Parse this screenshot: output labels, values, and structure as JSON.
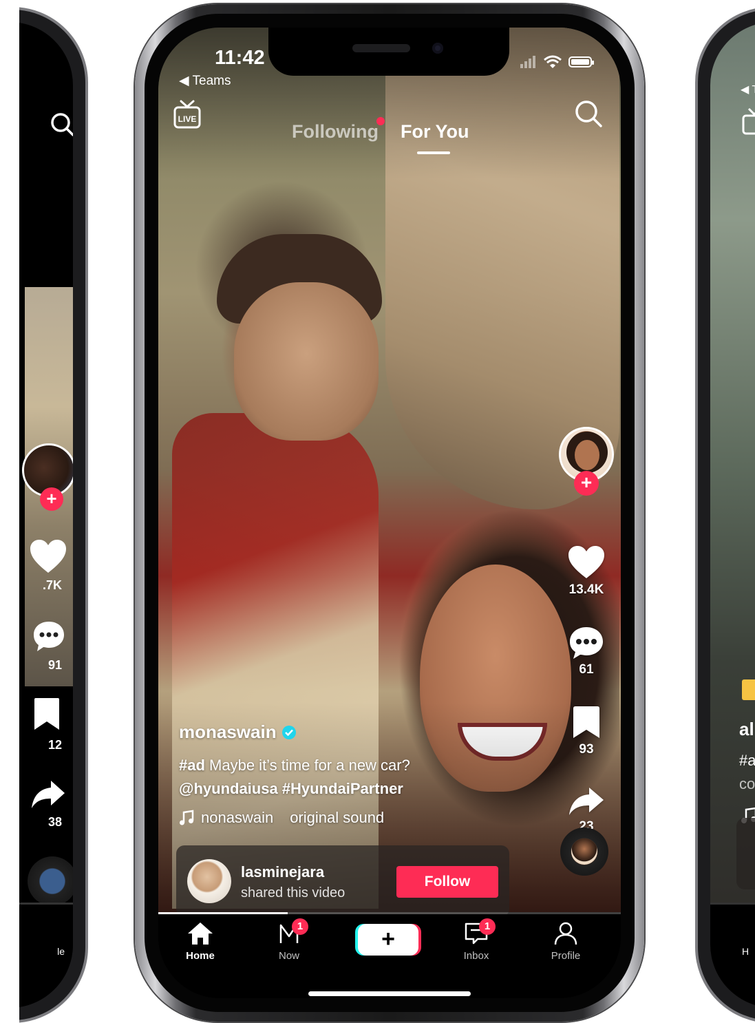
{
  "status_bar": {
    "time": "11:42",
    "back_app": "◀ Teams"
  },
  "top_tabs": {
    "following": "Following",
    "for_you": "For You",
    "active": "For You"
  },
  "post": {
    "username": "monaswain",
    "verified": true,
    "description_tag": "#ad",
    "description_text": " Maybe it’s time for a new car?",
    "description_line2": "@hyundaiusa #HyundaiPartner",
    "sound_author": "nonaswain",
    "sound_title": "original sound"
  },
  "actions": {
    "likes": "13.4K",
    "comments": "61",
    "saves": "93",
    "shares": "23"
  },
  "shared_by": {
    "name": "lasminejara",
    "subtitle": "shared this video",
    "follow_label": "Follow"
  },
  "bottom_nav": {
    "home": "Home",
    "now": "Now",
    "now_badge": "1",
    "create": "+",
    "inbox": "Inbox",
    "inbox_badge": "1",
    "profile": "Profile"
  },
  "left_phone": {
    "likes": ".7K",
    "comments": "91",
    "saves": "12",
    "shares": "38",
    "nav_label": "le"
  },
  "right_phone": {
    "username": "all",
    "desc_start": "#a",
    "desc_line2": "co",
    "back_app": "◀ T",
    "nav_label": "H"
  },
  "playback": {
    "progress": 0.28
  },
  "colors": {
    "accent": "#fe2c55",
    "cyan": "#25f4ee",
    "verified": "#20d5ec"
  },
  "icons": [
    "live-icon",
    "search-icon",
    "heart-icon",
    "comment-icon",
    "bookmark-icon",
    "share-icon",
    "music-note-icon",
    "home-icon",
    "now-icon",
    "inbox-icon",
    "profile-icon",
    "plus-icon",
    "wifi-icon",
    "battery-icon",
    "signal-icon"
  ]
}
